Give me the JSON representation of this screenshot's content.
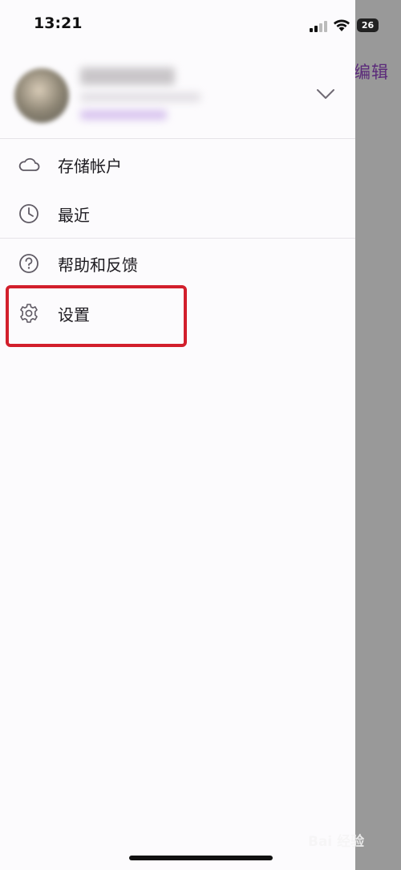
{
  "status_bar": {
    "time": "13:21",
    "battery": "26"
  },
  "behind_screen": {
    "edit_label": "编辑"
  },
  "account": {
    "name": "",
    "email": "",
    "link": ""
  },
  "menu": {
    "items": [
      {
        "label": "存储帐户",
        "icon": "cloud-icon"
      },
      {
        "label": "最近",
        "icon": "clock-icon"
      },
      {
        "label": "帮助和反馈",
        "icon": "help-icon"
      },
      {
        "label": "设置",
        "icon": "gear-icon"
      }
    ]
  },
  "watermark": "Bai 经验",
  "colors": {
    "drawer_bg": "#fcfbfd",
    "overlay": "#999999",
    "highlight": "#d21f2c",
    "accent": "#5b2a7a"
  }
}
